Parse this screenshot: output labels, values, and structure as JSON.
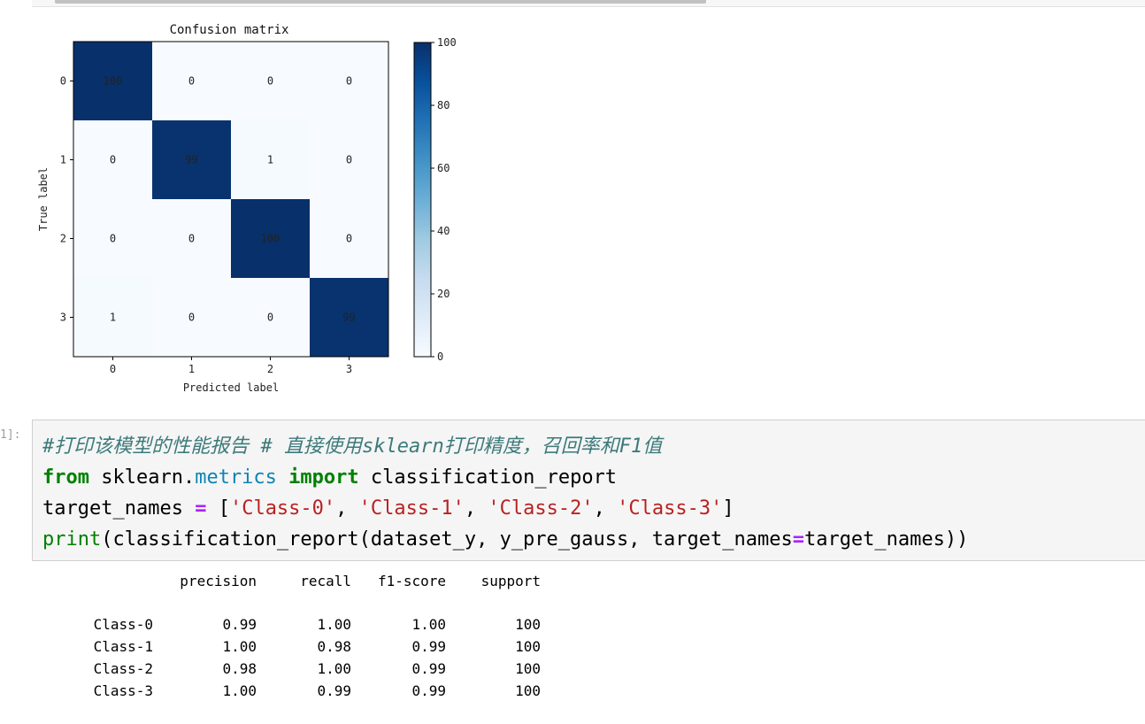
{
  "figure": {
    "title": "Confusion matrix",
    "xlabel": "Predicted label",
    "ylabel": "True label"
  },
  "chart_data": {
    "type": "heatmap",
    "title": "Confusion matrix",
    "xlabel": "Predicted label",
    "ylabel": "True label",
    "x_categories": [
      "0",
      "1",
      "2",
      "3"
    ],
    "y_categories": [
      "0",
      "1",
      "2",
      "3"
    ],
    "values": [
      [
        100,
        0,
        0,
        0
      ],
      [
        0,
        99,
        1,
        0
      ],
      [
        0,
        0,
        100,
        0
      ],
      [
        1,
        0,
        0,
        99
      ]
    ],
    "colormap": "Blues",
    "colorbar": {
      "min": 0,
      "max": 100,
      "ticks": [
        0,
        20,
        40,
        60,
        80,
        100
      ]
    },
    "colors": {
      "low": "#f7fbff",
      "high": "#08306b"
    }
  },
  "cell": {
    "prompt": "1]:",
    "code": {
      "comment": "#打印该模型的性能报告 # 直接使用sklearn打印精度，召回率和F1值",
      "line2": {
        "kw_from": "from",
        "mod_sklearn": "sklearn",
        "dot": ".",
        "mod_metrics": "metrics",
        "kw_import": "import",
        "name": "classification_report"
      },
      "line3": {
        "var": "target_names",
        "op": "=",
        "open": "[",
        "s0": "'Class-0'",
        "s1": "'Class-1'",
        "s2": "'Class-2'",
        "s3": "'Class-3'",
        "close": "]",
        "sep": ", "
      },
      "line4": {
        "fn": "print",
        "rest_a": "(classification_report(dataset_y, y_pre_gauss, target_names",
        "op": "=",
        "rest_b": "target_names))"
      }
    }
  },
  "report": {
    "headers": [
      "precision",
      "recall",
      "f1-score",
      "support"
    ],
    "rows": [
      {
        "label": "Class-0",
        "precision": "0.99",
        "recall": "1.00",
        "f1": "1.00",
        "support": "100"
      },
      {
        "label": "Class-1",
        "precision": "1.00",
        "recall": "0.98",
        "f1": "0.99",
        "support": "100"
      },
      {
        "label": "Class-2",
        "precision": "0.98",
        "recall": "1.00",
        "f1": "0.99",
        "support": "100"
      },
      {
        "label": "Class-3",
        "precision": "1.00",
        "recall": "0.99",
        "f1": "0.99",
        "support": "100"
      }
    ]
  }
}
